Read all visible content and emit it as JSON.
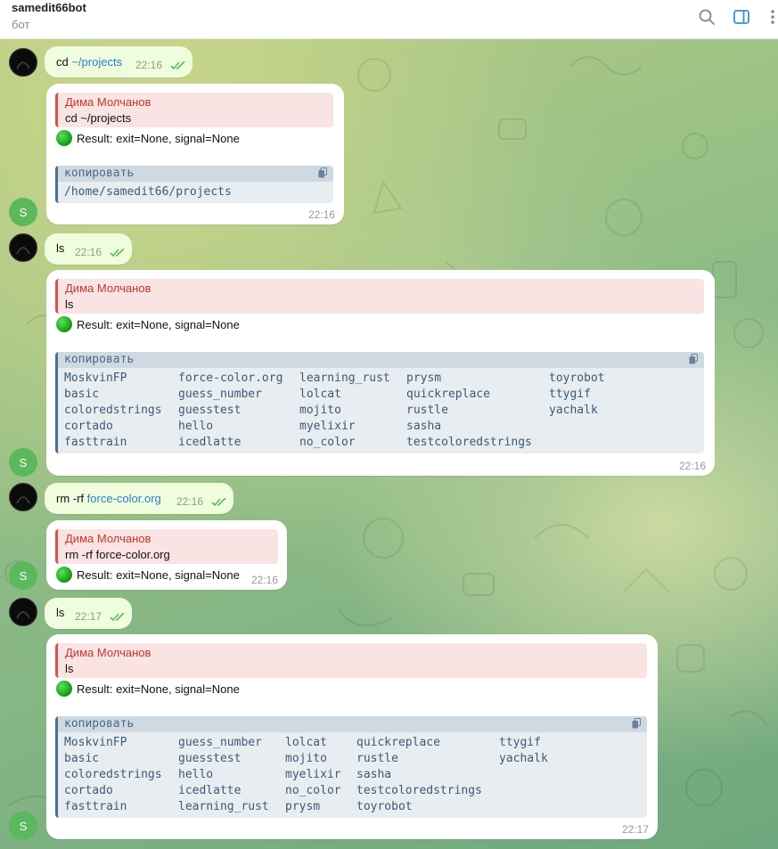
{
  "header": {
    "title": "samedit66bot",
    "subtitle": "бот"
  },
  "icons": {
    "search": "search-icon",
    "sidebar": "sidebar-toggle-icon",
    "more": "more-vertical-icon"
  },
  "colors": {
    "quote_accent": "#d45353",
    "link": "#2a7ec6",
    "bot_avatar": "#5cb85c",
    "status_dot": "#1aa51a"
  },
  "avatar_bot_letter": "S",
  "copy_label": "копировать",
  "quote_author": "Дима Молчанов",
  "result_text": "Result: exit=None, signal=None",
  "messages": {
    "m1": {
      "prefix": "cd ",
      "link": "~/projects",
      "time": "22:16"
    },
    "r1": {
      "quote": "cd ~/projects",
      "code": "/home/samedit66/projects",
      "time": "22:16"
    },
    "m2": {
      "text": "ls",
      "time": "22:16"
    },
    "r2": {
      "quote": "ls",
      "time": "22:16",
      "cols": [
        [
          "MoskvinFP",
          "basic",
          "coloredstrings",
          "cortado",
          "fasttrain"
        ],
        [
          "force-color.org",
          "guess_number",
          "guesstest",
          "hello",
          "icedlatte"
        ],
        [
          "learning_rust",
          "lolcat",
          "mojito",
          "myelixir",
          "no_color"
        ],
        [
          "prysm",
          "quickreplace",
          "rustle",
          "sasha",
          "testcoloredstrings"
        ],
        [
          "toyrobot",
          "ttygif",
          "yachalk"
        ]
      ]
    },
    "m3": {
      "prefix": "rm -rf ",
      "link": "force-color.org",
      "time": "22:16"
    },
    "r3": {
      "quote": "rm -rf force-color.org",
      "time": "22:16"
    },
    "m4": {
      "text": "ls",
      "time": "22:17"
    },
    "r4": {
      "quote": "ls",
      "time": "22:17",
      "cols": [
        [
          "MoskvinFP",
          "basic",
          "coloredstrings",
          "cortado",
          "fasttrain"
        ],
        [
          "guess_number",
          "guesstest",
          "hello",
          "icedlatte",
          "learning_rust"
        ],
        [
          "lolcat",
          "mojito",
          "myelixir",
          "no_color",
          "prysm"
        ],
        [
          "quickreplace",
          "rustle",
          "sasha",
          "testcoloredstrings",
          "toyrobot"
        ],
        [
          "ttygif",
          "yachalk"
        ]
      ]
    }
  }
}
